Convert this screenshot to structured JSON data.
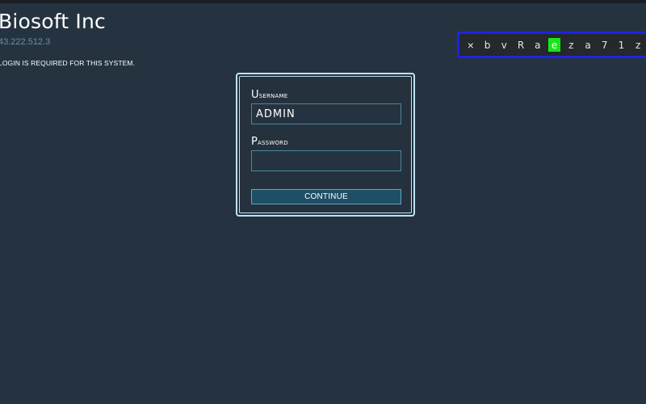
{
  "header": {
    "org_name": "Biosoft Inc",
    "ip_address": "43.222.512.3",
    "notice": "Login is required for this system."
  },
  "char_strip": {
    "close_icon": "×",
    "keys": [
      "b",
      "v",
      "R",
      "a",
      "e",
      "z",
      "a",
      "7",
      "1",
      "z"
    ],
    "active_index": 4,
    "colors": {
      "border": "#1f22e6",
      "active": "#19e619"
    }
  },
  "login": {
    "username_label": "Username",
    "username_value": "ADMIN",
    "password_label": "Password",
    "password_value": "",
    "continue_label": "CONTINUE"
  },
  "colors": {
    "background": "#253341",
    "accent": "#bde3f2",
    "input_border": "#4c86a0",
    "button_bg": "#1f4f66"
  }
}
